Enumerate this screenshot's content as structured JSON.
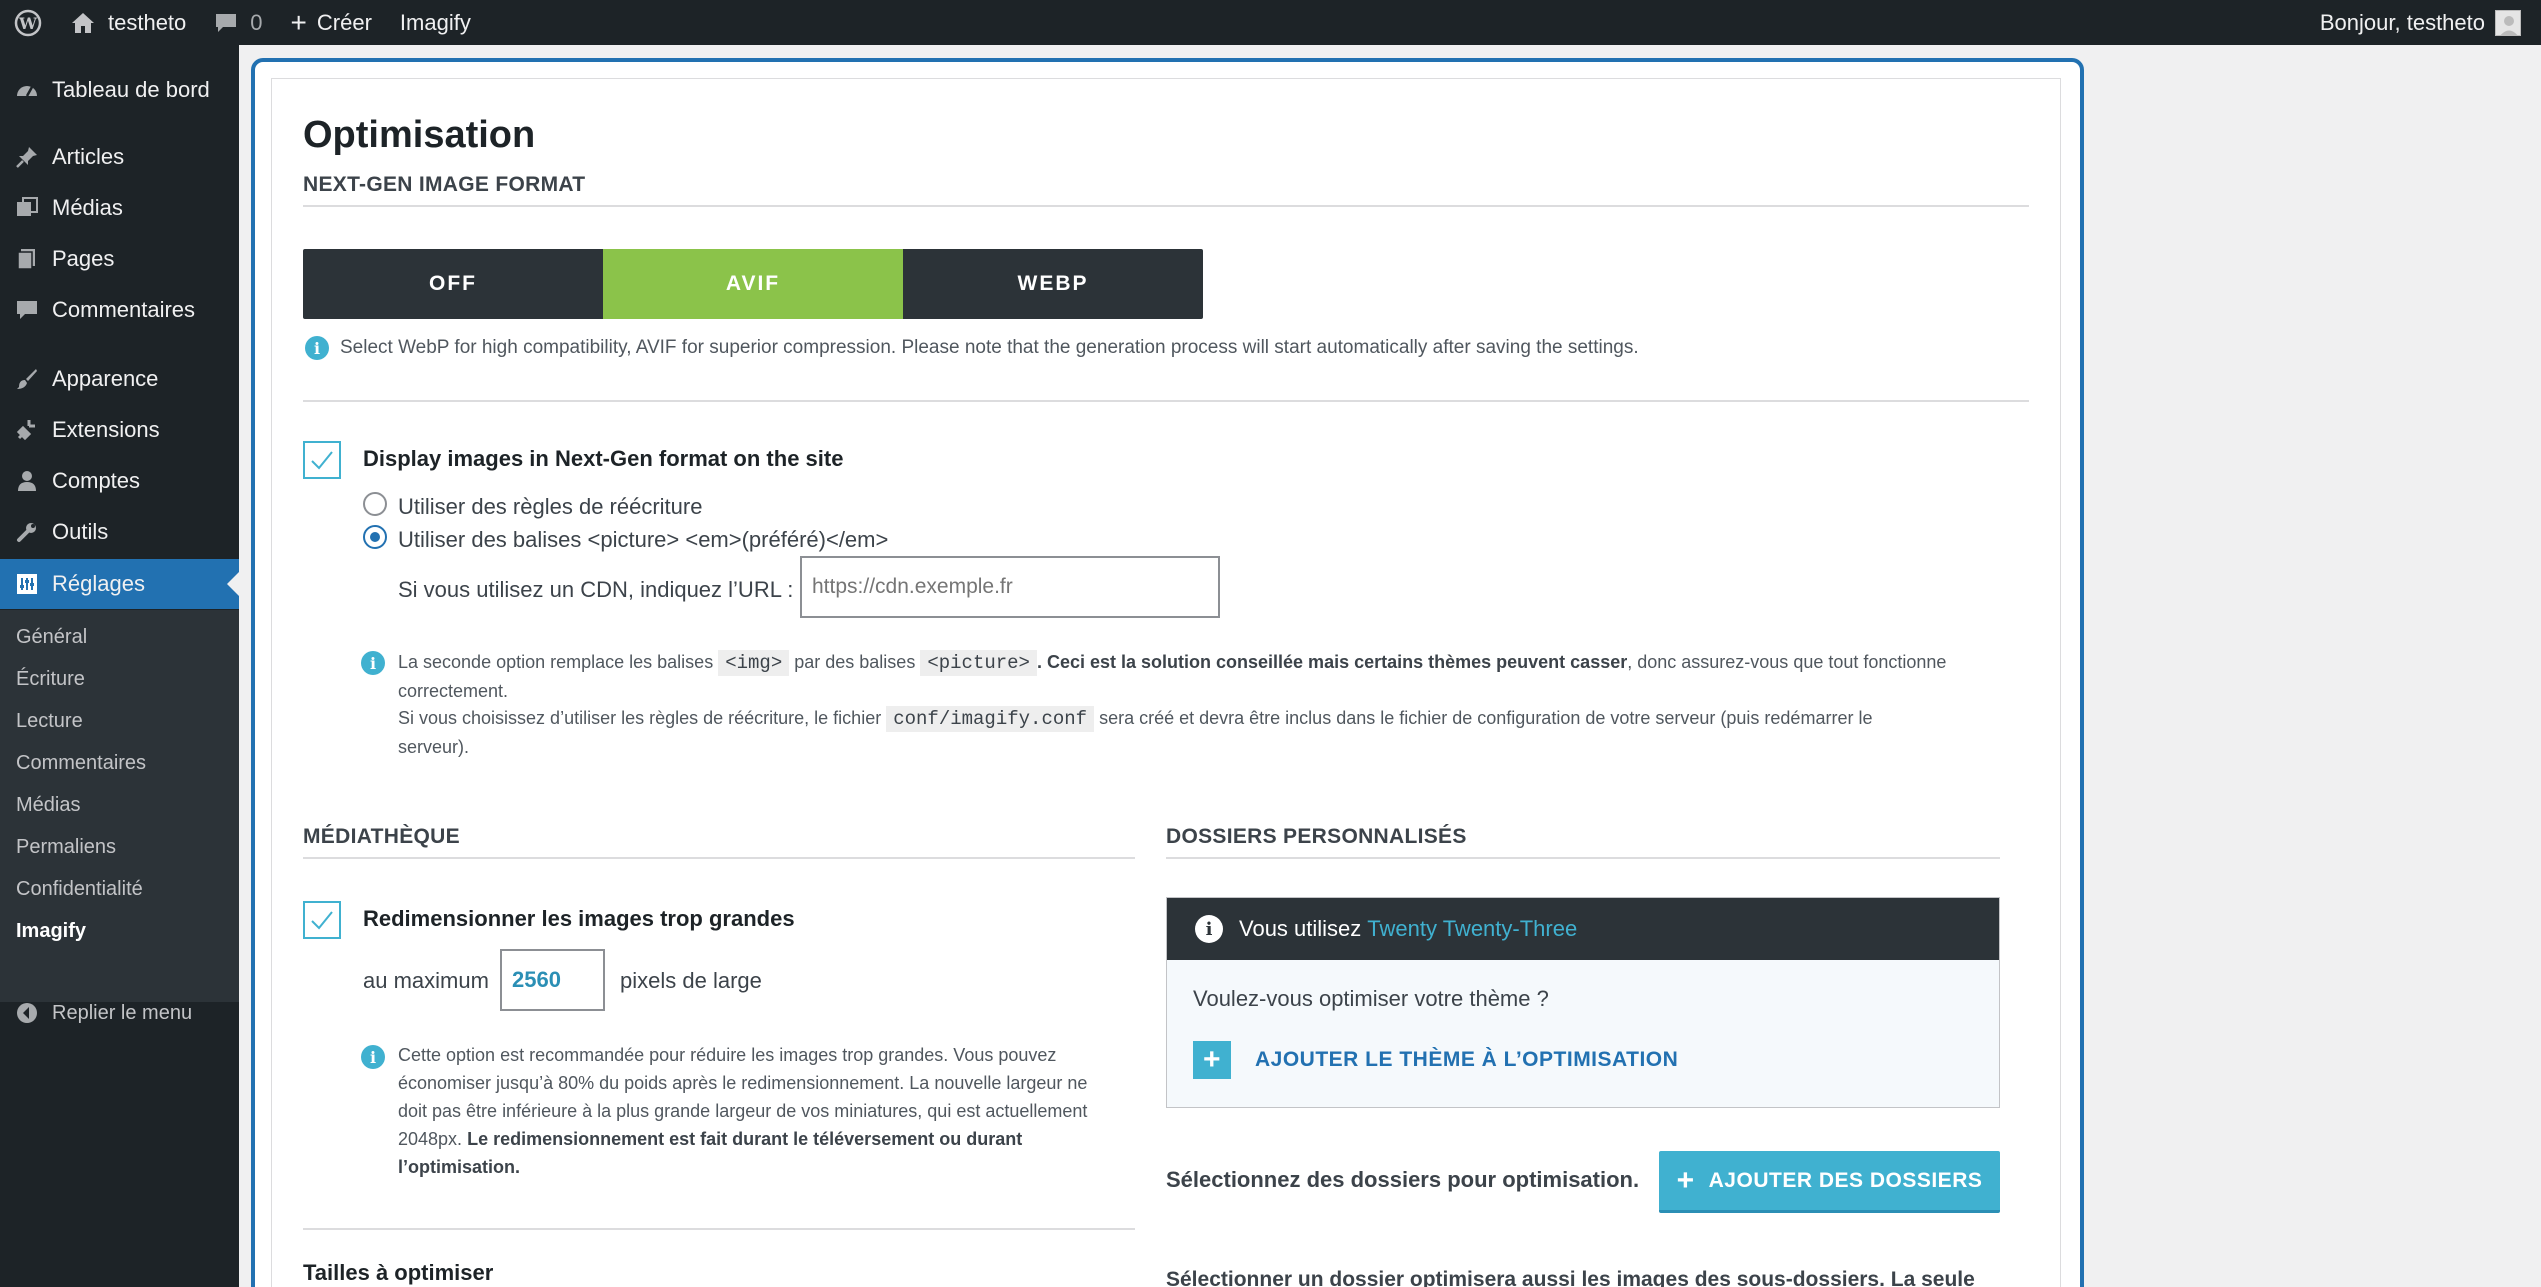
{
  "adminbar": {
    "site_name": "testheto",
    "comments_count": "0",
    "new_label": "Créer",
    "imagify_label": "Imagify",
    "greeting": "Bonjour, testheto"
  },
  "sidebar": {
    "items": [
      {
        "label": "Tableau de bord",
        "icon": "dashboard-icon"
      },
      {
        "label": "Articles",
        "icon": "pin-icon"
      },
      {
        "label": "Médias",
        "icon": "media-icon"
      },
      {
        "label": "Pages",
        "icon": "pages-icon"
      },
      {
        "label": "Commentaires",
        "icon": "comments-icon"
      },
      {
        "label": "Apparence",
        "icon": "brush-icon"
      },
      {
        "label": "Extensions",
        "icon": "plugin-icon"
      },
      {
        "label": "Comptes",
        "icon": "user-icon"
      },
      {
        "label": "Outils",
        "icon": "wrench-icon"
      },
      {
        "label": "Réglages",
        "icon": "settings-icon"
      }
    ],
    "submenu": [
      "Général",
      "Écriture",
      "Lecture",
      "Commentaires",
      "Médias",
      "Permaliens",
      "Confidentialité",
      "Imagify"
    ],
    "collapse_label": "Replier le menu"
  },
  "main": {
    "title": "Optimisation",
    "nextgen": {
      "section_title": "NEXT-GEN IMAGE FORMAT",
      "options": [
        "OFF",
        "AVIF",
        "WEBP"
      ],
      "selected": "AVIF",
      "note": "Select WebP for high compatibility, AVIF for superior compression. Please note that the generation process will start automatically after saving the settings.",
      "display_label": "Display images in Next-Gen format on the site",
      "radio1": "Utiliser des règles de réécriture",
      "radio2": "Utiliser des balises <picture> <em>(préféré)</em>",
      "cdn_label": "Si vous utilisez un CDN, indiquez l’URL :",
      "cdn_placeholder": "https://cdn.exemple.fr",
      "note2_a": "La seconde option remplace les balises",
      "note2_code1": "<img>",
      "note2_b": "par des balises",
      "note2_code2": "<picture>",
      "note2_bold": ". Ceci est la solution conseillée mais certains thèmes peuvent casser",
      "note2_c": ", donc assurez-vous que tout fonctionne",
      "note2_d": "correctement.",
      "note3_a": "Si vous choisissez d’utiliser les règles de réécriture, le fichier",
      "note3_code": "conf/imagify.conf",
      "note3_b": "sera créé et devra être inclus dans le fichier de configuration de votre serveur (puis redémarrer le",
      "note3_c": "serveur)."
    },
    "media": {
      "section_title": "MÉDIATHÈQUE",
      "resize_label": "Redimensionner les images trop grandes",
      "max_prefix": "au maximum",
      "max_value": "2560",
      "max_suffix": "pixels de large",
      "note_lines": [
        "Cette option est recommandée pour réduire les images trop grandes. Vous pouvez",
        "économiser jusqu’à 80% du poids après le redimensionnement. La nouvelle largeur ne",
        "doit pas être inférieure à la plus grande largeur de vos miniatures, qui est actuellement",
        "2048px."
      ],
      "note_bold1": "Le redimensionnement est fait durant le téléversement ou durant",
      "note_bold2": "l’optimisation.",
      "sizes_title": "Tailles à optimiser"
    },
    "custom": {
      "section_title": "DOSSIERS PERSONNALISÉS",
      "theme_prefix": "Vous utilisez",
      "theme_name": "Twenty Twenty-Three",
      "theme_question": "Voulez-vous optimiser votre thème ?",
      "add_theme": "AJOUTER LE THÈME À L’OPTIMISATION",
      "select_label": "Sélectionnez des dossiers pour optimisation.",
      "add_folders": "AJOUTER DES DOSSIERS",
      "bottom_text": "Sélectionner un dossier optimisera aussi les images des sous-dossiers. La seule"
    }
  }
}
